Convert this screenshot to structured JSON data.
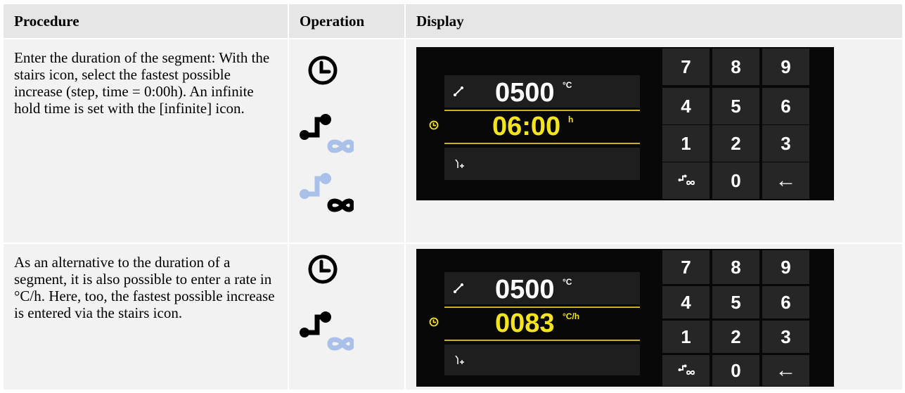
{
  "headers": {
    "procedure": "Procedure",
    "operation": "Operation",
    "display": "Display"
  },
  "rows": [
    {
      "procedure": "Enter the duration of the segment: With the stairs icon, select the fastest possible increase (step, time = 0:00h). An infinite hold time is set with the [infinite] icon.",
      "display": {
        "temperature": "0500",
        "temperature_unit": "°C",
        "second_value": "06:00",
        "second_unit": "h"
      }
    },
    {
      "procedure": "As an alternative to the duration of a segment, it is also possible to enter a rate in °C/h. Here, too, the fastest possible increase is entered via the stairs icon.",
      "display": {
        "temperature": "0500",
        "temperature_unit": "°C",
        "second_value": "0083",
        "second_unit": "°C/h"
      }
    }
  ],
  "keypad": [
    "7",
    "8",
    "9",
    "4",
    "5",
    "6",
    "1",
    "2",
    "3",
    "stairs-infinite",
    "0",
    "←"
  ],
  "keypad_labels": {
    "k0": "7",
    "k1": "8",
    "k2": "9",
    "k3": "4",
    "k4": "5",
    "k5": "6",
    "k6": "1",
    "k7": "2",
    "k8": "3",
    "k10": "0",
    "k11": "←"
  },
  "colors": {
    "accent_yellow": "#f4e320",
    "screen_bg": "#080808",
    "icon_blue": "#a9c0e8",
    "icon_black": "#000000"
  },
  "icons": [
    "clock-icon",
    "stairs-icon",
    "infinite-icon",
    "ramp-icon",
    "segment-add-icon"
  ]
}
